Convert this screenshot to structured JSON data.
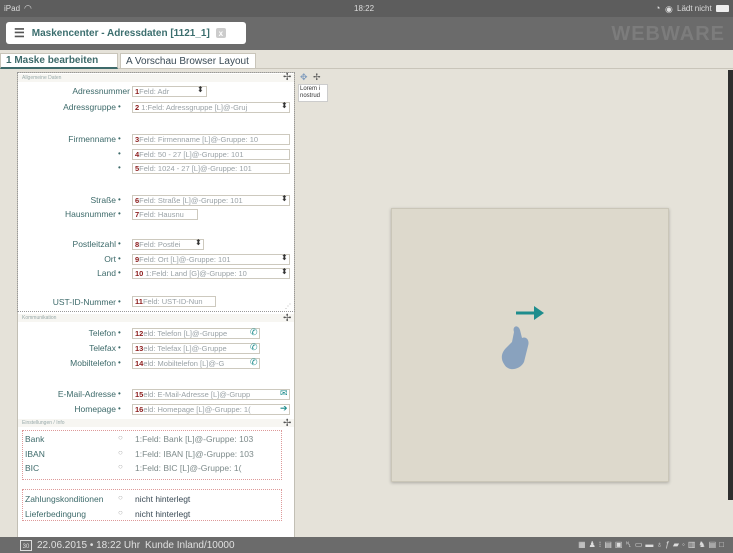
{
  "statusbar": {
    "device": "iPad",
    "time": "18:22",
    "charge": "Lädt nicht"
  },
  "window": {
    "title": "Maskencenter - Adressdaten [1121_1]",
    "close": "x",
    "brand": "WEBWARE"
  },
  "tabs": [
    {
      "label": "1 Maske bearbeiten"
    },
    {
      "label": "A Vorschau Browser Layout"
    }
  ],
  "sections": {
    "general": "Allgemeine Daten",
    "communication": "Kommunikation",
    "settings": "Einstellungen / Info"
  },
  "preview": {
    "line1": "Lorem i",
    "line2": "nostrud"
  },
  "general_fields": [
    {
      "label": "Adressnummer",
      "dot": "",
      "num": "1",
      "text": "Feld: Adr"
    },
    {
      "label": "Adressgruppe",
      "dot": "•",
      "num": "2",
      "text": "1:Feld: Adressgruppe [L]@-Gruj"
    },
    {
      "label": "Firmenname",
      "dot": "•",
      "num": "3",
      "text": "Feld: Firmenname [L]@-Gruppe: 10"
    },
    {
      "label": "",
      "dot": "•",
      "num": "4",
      "text": "Feld: 50 - 27 [L]@-Gruppe: 101"
    },
    {
      "label": "",
      "dot": "•",
      "num": "5",
      "text": "Feld: 1024 - 27 [L]@-Gruppe: 101"
    },
    {
      "label": "Straße",
      "dot": "•",
      "num": "6",
      "text": "Feld: Straße [L]@-Gruppe: 101"
    },
    {
      "label": "Hausnummer",
      "dot": "•",
      "num": "7",
      "text": "Feld: Hausnu"
    },
    {
      "label": "Postleitzahl",
      "dot": "•",
      "num": "8",
      "text": "Feld: Postlei"
    },
    {
      "label": "Ort",
      "dot": "•",
      "num": "9",
      "text": "Feld: Ort [L]@-Gruppe: 101"
    },
    {
      "label": "Land",
      "dot": "•",
      "num": "10",
      "text": "1:Feld: Land [G]@-Gruppe: 10"
    },
    {
      "label": "UST-ID-Nummer",
      "dot": "•",
      "num": "11",
      "text": "Feld: UST-ID-Nun"
    }
  ],
  "comm_fields": [
    {
      "label": "Telefon",
      "dot": "•",
      "num": "12",
      "text": "eld: Telefon [L]@-Gruppe"
    },
    {
      "label": "Telefax",
      "dot": "•",
      "num": "13",
      "text": "eld: Telefax [L]@-Gruppe"
    },
    {
      "label": "Mobiltelefon",
      "dot": "•",
      "num": "14",
      "text": "eld: Mobiltelefon [L]@-G"
    },
    {
      "label": "E-Mail-Adresse",
      "dot": "•",
      "num": "15",
      "text": "eld: E-Mail-Adresse [L]@-Grupp"
    },
    {
      "label": "Homepage",
      "dot": "•",
      "num": "16",
      "text": "eld: Homepage [L]@-Gruppe: 1("
    }
  ],
  "settings_fields": [
    {
      "label": "Bank",
      "value": "1:Feld: Bank [L]@-Gruppe: 103"
    },
    {
      "label": "IBAN",
      "value": "1:Feld: IBAN [L]@-Gruppe: 103"
    },
    {
      "label": "BIC",
      "value": "1:Feld: BIC [L]@-Gruppe: 1("
    },
    {
      "label": "Zahlungskonditionen",
      "value": "nicht hinterlegt"
    },
    {
      "label": "Lieferbedingung",
      "value": "nicht hinterlegt"
    }
  ],
  "bottombar": {
    "day": "30",
    "datetime": "22.06.2015 • 18:22 Uhr",
    "customer": "Kunde Inland/10000"
  },
  "colors": {
    "accent": "#3d6a6a",
    "field_number": "#8b1a1a",
    "arrow": "#1e8d8d",
    "hand": "#7f9bbd"
  }
}
